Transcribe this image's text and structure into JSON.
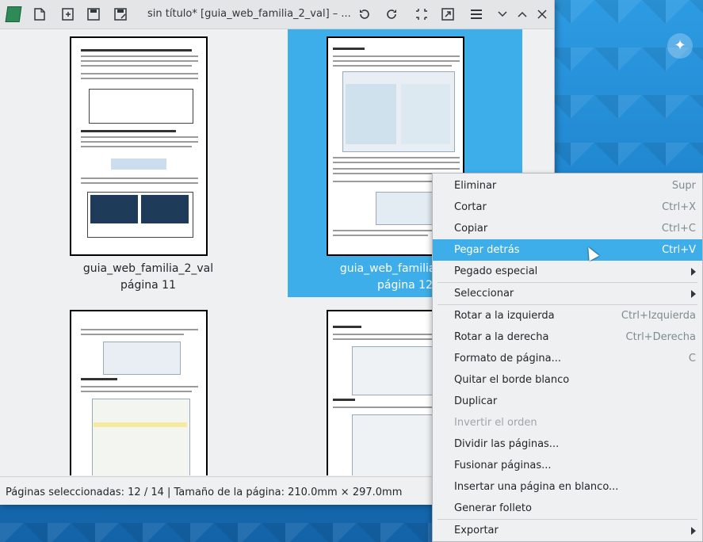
{
  "window": {
    "title": "sin título* [guia_web_familia_2_val] – ..."
  },
  "toolbar": {
    "icons": [
      "new-page-icon",
      "insert-image-icon",
      "save-icon",
      "save-as-icon",
      "rotate-left-icon",
      "rotate-right-icon",
      "crop-icon",
      "export-icon",
      "menu-icon",
      "minimize-icon",
      "maximize-icon",
      "close-icon"
    ]
  },
  "thumbnails": [
    {
      "name": "guia_web_familia_2_val",
      "page": "página 11"
    },
    {
      "name": "guia_web_familia_2_val",
      "page": "página 12"
    },
    {
      "name": "",
      "page": ""
    },
    {
      "name": "",
      "page": ""
    }
  ],
  "status": {
    "text": "Páginas seleccionadas: 12 / 14 | Tamaño de la página: 210.0mm × 297.0mm"
  },
  "context_menu": {
    "items": [
      {
        "label": "Eliminar",
        "shortcut": "Supr"
      },
      {
        "label": "Cortar",
        "shortcut": "Ctrl+X"
      },
      {
        "label": "Copiar",
        "shortcut": "Ctrl+C"
      },
      {
        "label": "Pegar detrás",
        "shortcut": "Ctrl+V"
      },
      {
        "label": "Pegado especial",
        "shortcut": ""
      },
      {
        "label": "Seleccionar",
        "shortcut": ""
      },
      {
        "label": "Rotar a la izquierda",
        "shortcut": "Ctrl+Izquierda"
      },
      {
        "label": "Rotar a la derecha",
        "shortcut": "Ctrl+Derecha"
      },
      {
        "label": "Formato de página...",
        "shortcut": "C"
      },
      {
        "label": "Quitar el borde blanco",
        "shortcut": ""
      },
      {
        "label": "Duplicar",
        "shortcut": ""
      },
      {
        "label": "Invertir el orden",
        "shortcut": ""
      },
      {
        "label": "Dividir las páginas...",
        "shortcut": ""
      },
      {
        "label": "Fusionar páginas...",
        "shortcut": ""
      },
      {
        "label": "Insertar una página en blanco...",
        "shortcut": ""
      },
      {
        "label": "Generar folleto",
        "shortcut": ""
      },
      {
        "label": "Exportar",
        "shortcut": ""
      }
    ]
  },
  "colors": {
    "selection": "#3daee9",
    "window_bg": "#eff0f1",
    "desktop": "#1b7fc9"
  }
}
